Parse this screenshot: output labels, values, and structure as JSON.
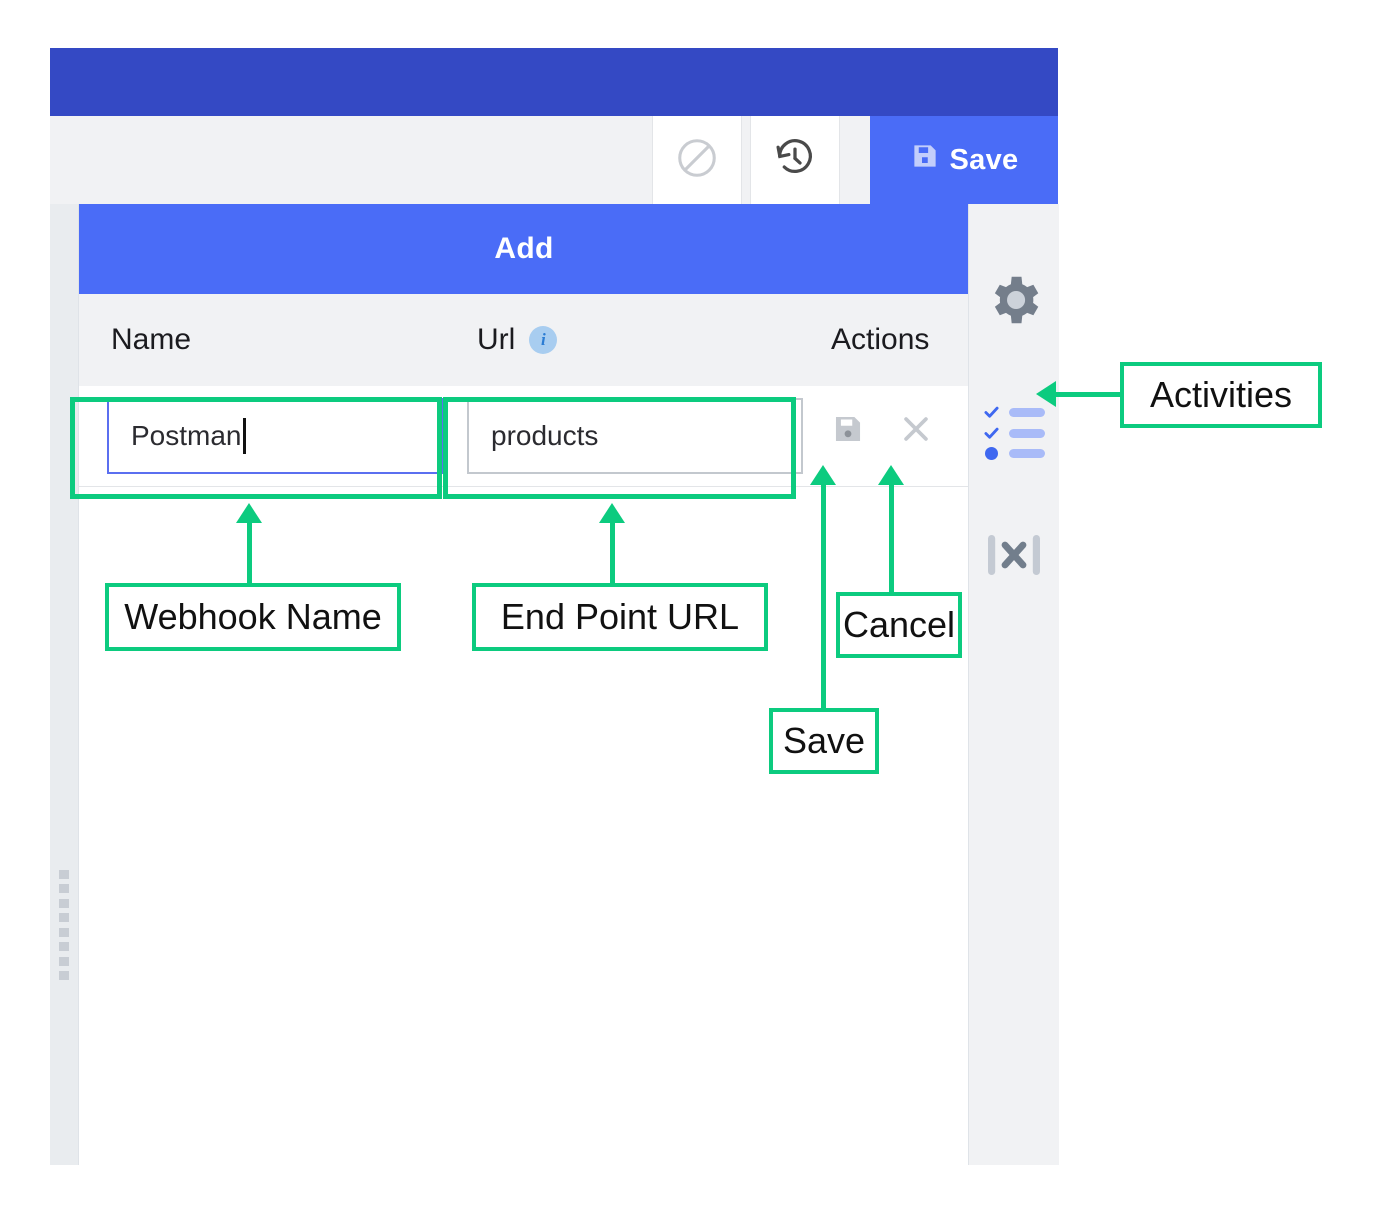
{
  "window": {
    "brand_bar_color": "#3449c4",
    "accent_color": "#4a6cf7",
    "annotation_color": "#0ccb7f"
  },
  "toolbar": {
    "block_icon": "no-entry-icon",
    "history_icon": "history-revert-icon",
    "save_label": "Save",
    "save_icon": "floppy-disk-icon"
  },
  "panel": {
    "title": "Add",
    "columns": {
      "name": "Name",
      "url": "Url",
      "url_info_icon": "info-icon",
      "actions": "Actions"
    },
    "rows": [
      {
        "name_value": "Postman",
        "url_value": "products",
        "save_icon": "floppy-disk-icon",
        "cancel_icon": "close-x-icon"
      }
    ]
  },
  "sidebar": {
    "items": [
      {
        "icon": "gear-icon",
        "name": "settings"
      },
      {
        "icon": "checklist-icon",
        "name": "activities"
      },
      {
        "icon": "collapse-x-icon",
        "name": "collapse"
      }
    ]
  },
  "annotations": [
    {
      "label": "Activities",
      "target": "activities-rail-icon"
    },
    {
      "label": "Webhook Name",
      "target": "name-input"
    },
    {
      "label": "End Point URL",
      "target": "url-input"
    },
    {
      "label": "Save",
      "target": "row-save-icon"
    },
    {
      "label": "Cancel",
      "target": "row-cancel-icon"
    }
  ]
}
